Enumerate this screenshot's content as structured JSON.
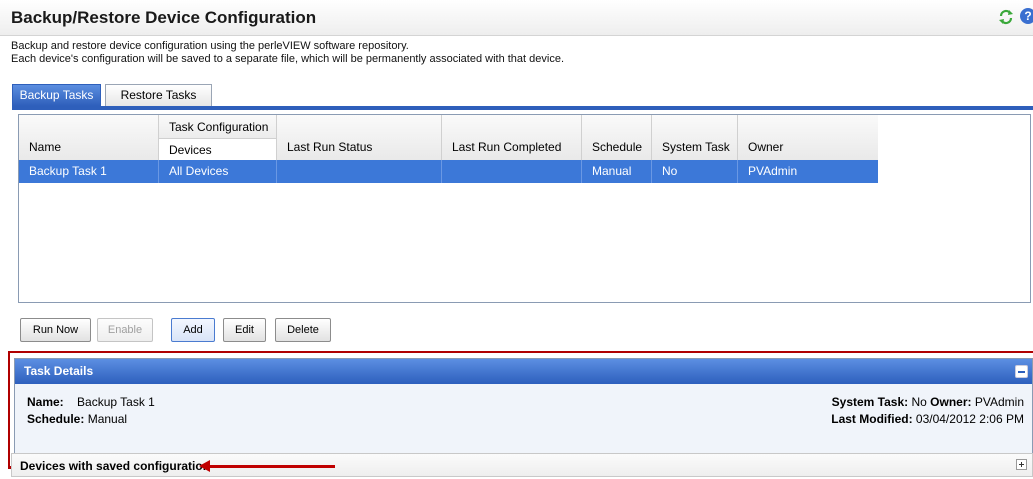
{
  "header": {
    "title": "Backup/Restore Device Configuration",
    "refresh_icon": "refresh-icon",
    "help_icon": "help-icon",
    "help_glyph": "?"
  },
  "description": {
    "line1": "Backup and restore device configuration using the perleVIEW software repository.",
    "line2": "Each device's configuration will be saved to a separate file, which will be permanently associated with that device."
  },
  "tabs": [
    {
      "label": "Backup Tasks",
      "active": true
    },
    {
      "label": "Restore Tasks",
      "active": false
    }
  ],
  "grid": {
    "group_header": "Task Configuration",
    "columns": [
      "Name",
      "Devices",
      "Last Run Status",
      "Last Run Completed",
      "Schedule",
      "System Task",
      "Owner"
    ],
    "rows": [
      {
        "name": "Backup Task 1",
        "devices": "All Devices",
        "last_run_status": "",
        "last_run_completed": "",
        "schedule": "Manual",
        "system_task": "No",
        "owner": "PVAdmin",
        "selected": true
      }
    ]
  },
  "buttons": {
    "run_now": "Run Now",
    "enable": "Enable",
    "add": "Add",
    "edit": "Edit",
    "delete": "Delete"
  },
  "task_details": {
    "title": "Task Details",
    "name_label": "Name:",
    "name_value": "Backup Task 1",
    "schedule_label": "Schedule:",
    "schedule_value": "Manual",
    "system_task_label": "System Task:",
    "system_task_value": "No",
    "owner_label": "Owner:",
    "owner_value": "PVAdmin",
    "last_modified_label": "Last Modified:",
    "last_modified_value": "03/04/2012 2:06 PM"
  },
  "devices_panel": {
    "title": "Devices with saved configuration"
  },
  "colors": {
    "accent": "#2e5fbb",
    "selection": "#3c78d8",
    "annotation": "#c00000"
  }
}
